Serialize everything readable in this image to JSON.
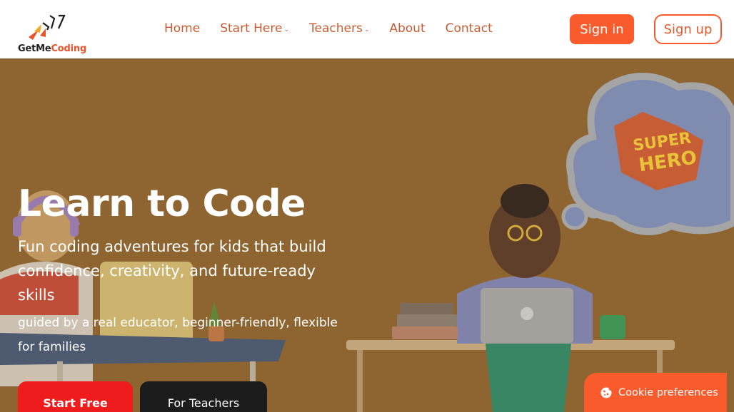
{
  "brand": {
    "name_part1": "GetMe",
    "name_part2": "Coding",
    "accent_color": "#fa5b2c"
  },
  "nav": {
    "items": [
      {
        "label": "Home",
        "has_dropdown": false
      },
      {
        "label": "Start Here",
        "has_dropdown": true
      },
      {
        "label": "Teachers",
        "has_dropdown": true
      },
      {
        "label": "About",
        "has_dropdown": false
      },
      {
        "label": "Contact",
        "has_dropdown": false
      }
    ],
    "caret": "⌄"
  },
  "auth": {
    "signin_label": "Sign in",
    "signup_label": "Sign up"
  },
  "hero": {
    "title": "Learn to Code",
    "subtitle": "Fun coding adventures for kids that build confidence, creativity, and future-ready skills",
    "subtitle2": "guided by a real educator, beginner-friendly, flexible for families",
    "primary_cta": "Start Free",
    "secondary_cta": "For Teachers",
    "background_color": "#8e6530",
    "illustration_bubble_text_line1": "SUPER",
    "illustration_bubble_text_line2": "HERO"
  },
  "cookie": {
    "label": "Cookie preferences",
    "icon": "cookie-icon"
  }
}
